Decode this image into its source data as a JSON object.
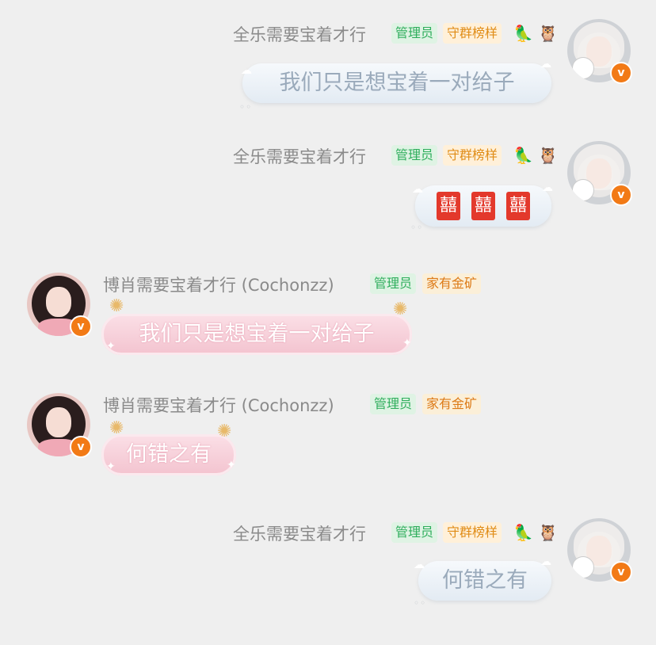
{
  "messages": [
    {
      "side": "right",
      "sender": "全乐需要宝着才行",
      "tags": [
        "管理员",
        "守群榜样"
      ],
      "icons": [
        "🦜",
        "🦉"
      ],
      "text": "我们只是想宝着一对给子",
      "bubble_style": "cloud"
    },
    {
      "side": "right",
      "sender": "全乐需要宝着才行",
      "tags": [
        "管理员",
        "守群榜样"
      ],
      "icons": [
        "🦜",
        "🦉"
      ],
      "text": "囍囍囍",
      "glyph": "囍",
      "bubble_style": "cloud"
    },
    {
      "side": "left",
      "sender": "博肖需要宝着才行 (Cochonzz)",
      "tags": [
        "管理员",
        "家有金矿"
      ],
      "text": "我们只是想宝着一对给子",
      "bubble_style": "pink"
    },
    {
      "side": "left",
      "sender": "博肖需要宝着才行 (Cochonzz)",
      "tags": [
        "管理员",
        "家有金矿"
      ],
      "text": "何错之有",
      "bubble_style": "pink"
    },
    {
      "side": "right",
      "sender": "全乐需要宝着才行",
      "tags": [
        "管理员",
        "守群榜样"
      ],
      "icons": [
        "🦜",
        "🦉"
      ],
      "text": "何错之有",
      "bubble_style": "cloud"
    }
  ],
  "badge_letter": "v",
  "colors": {
    "background": "#efefef",
    "admin_tag": "#2fae5c",
    "guard_tag": "#e08c16",
    "verified_badge": "#f27a16",
    "pink_bubble": "#f3c3cf",
    "cloud_bubble": "#e3ebf3"
  }
}
